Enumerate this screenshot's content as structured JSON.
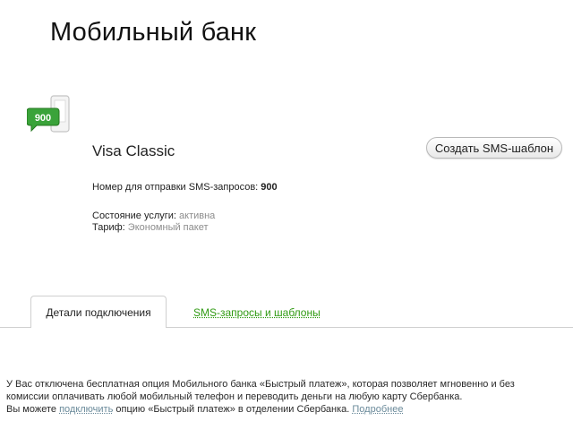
{
  "page": {
    "title": "Мобильный банк"
  },
  "sms_icon": {
    "number": "900",
    "colors": {
      "bubble": "#3aa33a",
      "bubble_border": "#24771f"
    }
  },
  "card": {
    "name": "Visa Classic"
  },
  "actions": {
    "create_template": "Создать SMS-шаблон"
  },
  "info": {
    "sms_number_label": "Номер для отправки SMS-запросов:",
    "sms_number_value": "900",
    "service_state_label": "Состояние услуги:",
    "service_state_value": "активна",
    "tariff_label": "Тариф:",
    "tariff_value": "Экономный пакет"
  },
  "tabs": [
    {
      "label": "Детали подключения",
      "active": true
    },
    {
      "label": "SMS-запросы и шаблоны",
      "active": false
    }
  ],
  "notice": {
    "line1": "У Вас отключена бесплатная опция Мобильного банка «Быстрый платеж», которая позволяет мгновенно и без",
    "line2": "комиссии оплачивать любой мобильный телефон и переводить деньги на любую карту Сбербанка.",
    "line3_prefix": "Вы можете",
    "link_connect": "подключить",
    "line3_middle": "опцию «Быстрый платеж» в отделении Сбербанка.",
    "link_more": "Подробнее"
  },
  "colors": {
    "link_green": "#2f9a12",
    "muted": "#8c8c8c"
  }
}
